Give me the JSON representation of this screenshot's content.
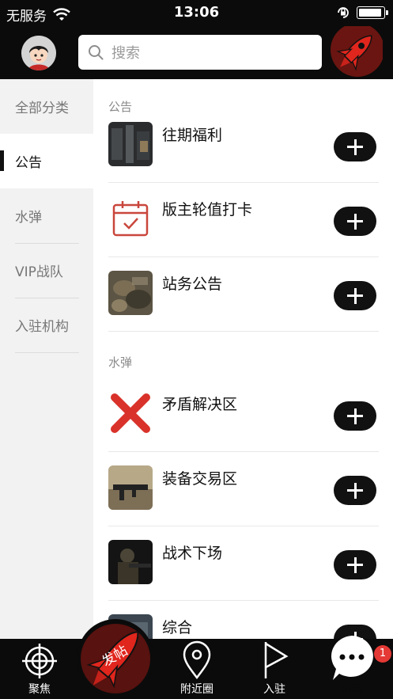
{
  "status_bar": {
    "carrier": "无服务",
    "time": "13:06",
    "battery_level": 0.95
  },
  "header": {
    "search_placeholder": "搜索"
  },
  "sidebar": {
    "items": [
      {
        "label": "全部分类",
        "active": false
      },
      {
        "label": "公告",
        "active": true
      },
      {
        "label": "水弹",
        "active": false
      },
      {
        "label": "VIP战队",
        "active": false
      },
      {
        "label": "入驻机构",
        "active": false
      }
    ]
  },
  "content": {
    "sections": [
      {
        "title": "公告",
        "rows": [
          {
            "label": "往期福利",
            "icon": "image-icon"
          },
          {
            "label": "版主轮值打卡",
            "icon": "calendar-check-icon"
          },
          {
            "label": "站务公告",
            "icon": "image-icon"
          }
        ]
      },
      {
        "title": "水弹",
        "rows": [
          {
            "label": "矛盾解决区",
            "icon": "red-x-icon"
          },
          {
            "label": "装备交易区",
            "icon": "image-icon"
          },
          {
            "label": "战术下场",
            "icon": "image-icon"
          },
          {
            "label": "综合",
            "icon": "image-icon"
          }
        ]
      }
    ]
  },
  "tabbar": {
    "tabs": [
      {
        "label": "聚焦",
        "icon": "crosshair-icon"
      },
      {
        "label": "发帖",
        "icon": "rocket-icon"
      },
      {
        "label": "附近圈",
        "icon": "location-pin-icon"
      },
      {
        "label": "入驻",
        "icon": "flag-icon"
      },
      {
        "label": "消息",
        "icon": "chat-bubble-icon"
      }
    ],
    "message_badge": "1"
  },
  "colors": {
    "bar_background": "#0b0b0b",
    "accent_red": "#d9281e",
    "sidebar_background": "#f2f2f2",
    "text_primary": "#111111",
    "text_secondary": "#8a8a8a"
  }
}
